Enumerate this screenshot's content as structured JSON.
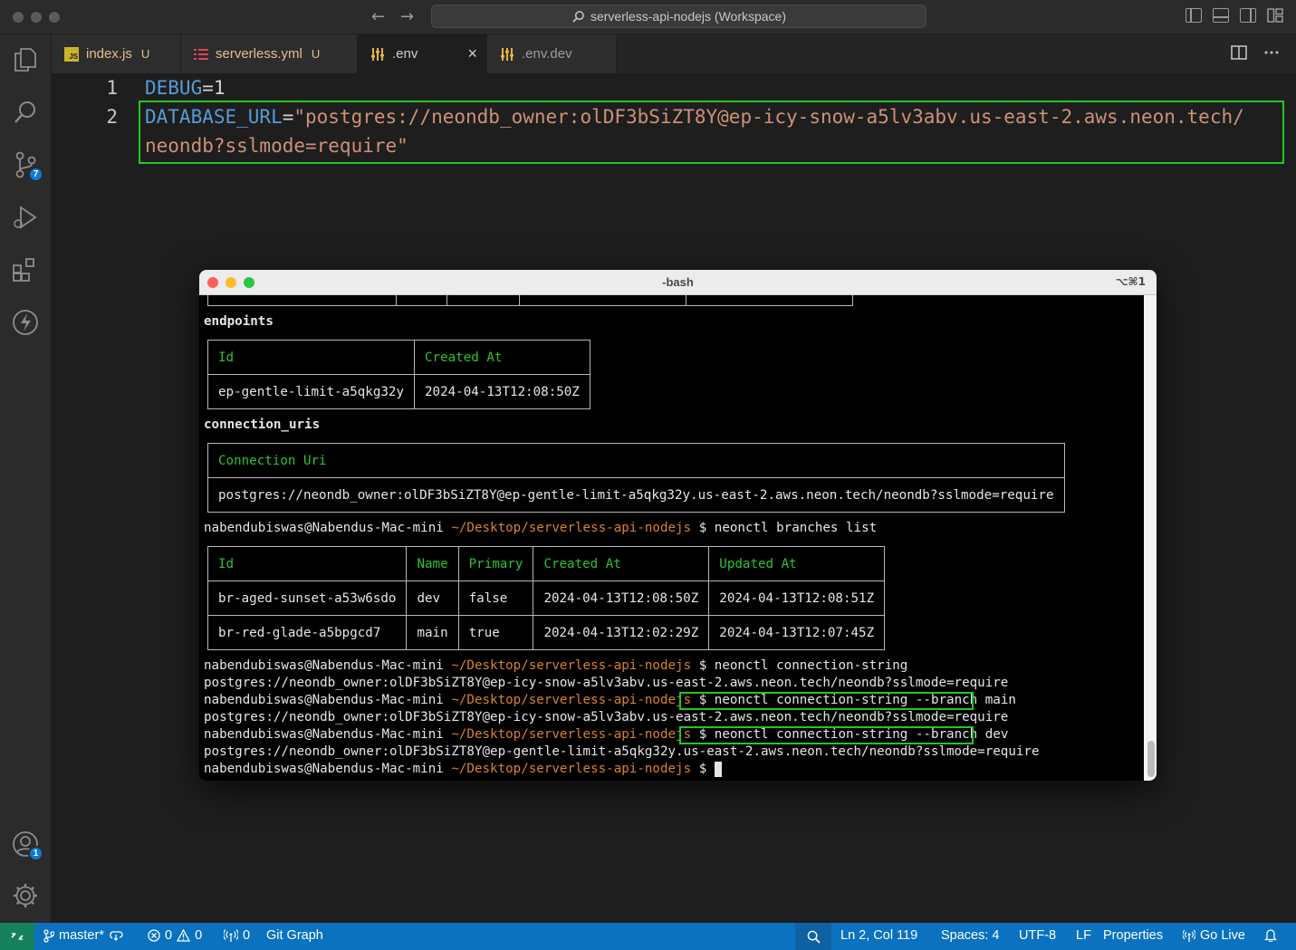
{
  "window": {
    "title": "serverless-api-nodejs (Workspace)"
  },
  "activity_bar": {
    "scm_badge": "7",
    "accounts_badge": "1"
  },
  "tabs": [
    {
      "label": "index.js",
      "status": "U",
      "icon": "JS"
    },
    {
      "label": "serverless.yml",
      "status": "U",
      "icon": "yaml-icon"
    },
    {
      "label": ".env",
      "status": "",
      "icon": "settings-lines-icon",
      "close": "×"
    },
    {
      "label": ".env.dev",
      "status": "",
      "icon": "settings-lines-icon"
    }
  ],
  "editor": {
    "line_numbers": [
      "1",
      "2"
    ],
    "line1": {
      "key": "DEBUG",
      "eq": "=",
      "value": "1"
    },
    "line2": {
      "key": "DATABASE_URL",
      "eq": "=",
      "value_part1": "\"postgres://neondb_owner:olDF3bSiZT8Y@ep-icy-snow-a5lv3abv.us-east-2.aws.neon.tech/",
      "value_part2": "neondb?sslmode=require\""
    }
  },
  "terminal": {
    "title": "-bash",
    "shortcut": "⌥⌘1",
    "endpoints_label": "endpoints",
    "endpoints_table": {
      "headers": [
        "Id",
        "Created At"
      ],
      "row": [
        "ep-gentle-limit-a5qkg32y",
        "2024-04-13T12:08:50Z"
      ]
    },
    "connection_uris_label": "connection_uris",
    "connection_table": {
      "header": "Connection Uri",
      "value": "postgres://neondb_owner:olDF3bSiZT8Y@ep-gentle-limit-a5qkg32y.us-east-2.aws.neon.tech/neondb?sslmode=require"
    },
    "prompt_user": "nabendubiswas@Nabendus-Mac-mini",
    "prompt_path": "~/Desktop/serverless-api-nodejs",
    "prompt_symbol": "$",
    "cmd_branches": "neonctl branches list",
    "branches_table": {
      "headers": [
        "Id",
        "Name",
        "Primary",
        "Created At",
        "Updated At"
      ],
      "rows": [
        [
          "br-aged-sunset-a53w6sdo",
          "dev",
          "false",
          "2024-04-13T12:08:50Z",
          "2024-04-13T12:08:51Z"
        ],
        [
          "br-red-glade-a5bpgcd7",
          "main",
          "true",
          "2024-04-13T12:02:29Z",
          "2024-04-13T12:07:45Z"
        ]
      ]
    },
    "cmd_conn": "neonctl connection-string",
    "out_conn": "postgres://neondb_owner:olDF3bSiZT8Y@ep-icy-snow-a5lv3abv.us-east-2.aws.neon.tech/neondb?sslmode=require",
    "cmd_conn_main": "neonctl connection-string --branch main",
    "out_conn_main": "postgres://neondb_owner:olDF3bSiZT8Y@ep-icy-snow-a5lv3abv.us-east-2.aws.neon.tech/neondb?sslmode=require",
    "cmd_conn_dev": "neonctl connection-string --branch dev",
    "out_conn_dev": "postgres://neondb_owner:olDF3bSiZT8Y@ep-gentle-limit-a5qkg32y.us-east-2.aws.neon.tech/neondb?sslmode=require"
  },
  "statusbar": {
    "branch": "master*",
    "errors": "0",
    "warnings": "0",
    "ports": "0",
    "git_graph": "Git Graph",
    "position": "Ln 2, Col 119",
    "spaces": "Spaces: 4",
    "encoding": "UTF-8",
    "eol": "LF",
    "language": "Properties",
    "go_live": "Go Live"
  }
}
